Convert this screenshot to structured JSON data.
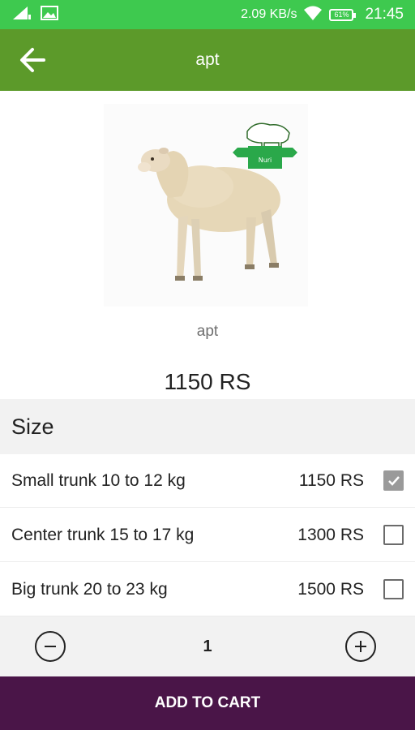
{
  "status_bar": {
    "speed": "2.09 KB/s",
    "battery": "61%",
    "time": "21:45"
  },
  "app_bar": {
    "title": "apt",
    "back_icon": "arrow-left-icon"
  },
  "product": {
    "name": "apt",
    "price": "1150 RS",
    "image_badge": "Nuri"
  },
  "size_section": {
    "title": "Size",
    "options": [
      {
        "label": "Small trunk 10 to 12 kg",
        "price": "1150 RS",
        "checked": true
      },
      {
        "label": "Center trunk 15 to 17 kg",
        "price": "1300 RS",
        "checked": false
      },
      {
        "label": "Big trunk 20 to 23 kg",
        "price": "1500 RS",
        "checked": false
      }
    ]
  },
  "quantity": {
    "value": "1",
    "minus_icon": "minus-circle-icon",
    "plus_icon": "plus-circle-icon"
  },
  "cart_button": {
    "label": "ADD TO CART"
  },
  "colors": {
    "status_bar": "#3ec94f",
    "app_bar": "#5c9a2a",
    "cart_button": "#4a1548",
    "section_bg": "#f2f2f2"
  }
}
